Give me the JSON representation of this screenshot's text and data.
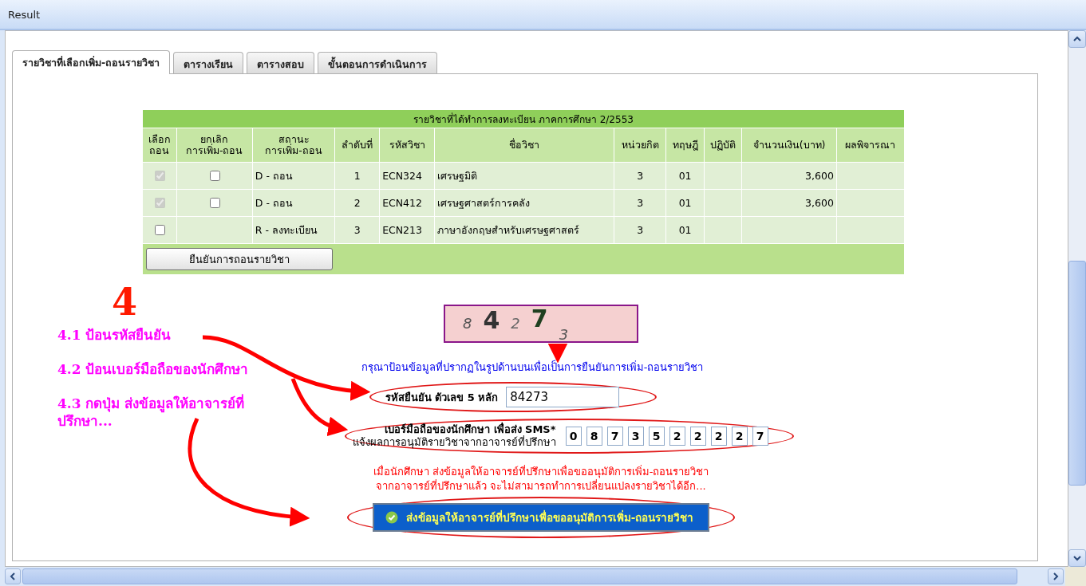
{
  "window": {
    "title": "Result"
  },
  "tabs": [
    {
      "label": "รายวิชาที่เลือกเพิ่ม-ถอนรายวิชา",
      "selected": true
    },
    {
      "label": "ตารางเรียน",
      "selected": false
    },
    {
      "label": "ตารางสอบ",
      "selected": false
    },
    {
      "label": "ขั้นตอนการดำเนินการ",
      "selected": false
    }
  ],
  "table": {
    "caption": "รายวิชาที่ได้ทำการลงทะเบียน ภาคการศึกษา 2/2553",
    "columns": [
      "เลือก\nถอน",
      "ยกเลิก\nการเพิ่ม-ถอน",
      "สถานะ\nการเพิ่ม-ถอน",
      "ลำดับที่",
      "รหัสวิชา",
      "ชื่อวิชา",
      "หน่วยกิต",
      "ทฤษฎี",
      "ปฏิบัติ",
      "จำนวนเงิน(บาท)",
      "ผลพิจารณา"
    ],
    "rows": [
      {
        "select": {
          "checked": true,
          "disabled": true
        },
        "cancel": {
          "checked": false
        },
        "status": "D - ถอน",
        "no": "1",
        "code": "ECN324",
        "name": "เศรษฐมิติ",
        "credits": "3",
        "theory": "01",
        "amount": "3,600"
      },
      {
        "select": {
          "checked": true,
          "disabled": true
        },
        "cancel": {
          "checked": false
        },
        "status": "D - ถอน",
        "no": "2",
        "code": "ECN412",
        "name": "เศรษฐศาสตร์การคลัง",
        "credits": "3",
        "theory": "01",
        "amount": "3,600"
      },
      {
        "select": {
          "checked": false,
          "disabled": false
        },
        "status": "R - ลงทะเบียน",
        "no": "3",
        "code": "ECN213",
        "name": "ภาษาอังกฤษสำหรับเศรษฐศาสตร์",
        "credits": "3",
        "theory": "01"
      }
    ],
    "button": "ยืนยันการถอนรายวิชา"
  },
  "captcha": [
    "8",
    "4",
    "2",
    "7",
    "3"
  ],
  "instruction": "กรุณาป้อนข้อมูลที่ปรากฏในรูปด้านบนเพื่อเป็นการยืนยันการเพิ่ม-ถอนรายวิชา",
  "code_field": {
    "label": "รหัสยืนยัน ตัวเลข 5 หลัก",
    "value": "84273"
  },
  "phone_field": {
    "label_lines": [
      "เบอร์มือถือของนักศึกษา เพื่อส่ง SMS*",
      "แจ้งผลการอนุมัติรายวิชาจากอาจารย์ที่ปรึกษา"
    ],
    "digits": [
      "0",
      "8",
      "7",
      "3",
      "5",
      "2",
      "2",
      "2",
      "2",
      "7"
    ]
  },
  "warning_lines": [
    "เมื่อนักศึกษา ส่งข้อมูลให้อาจารย์ที่ปรึกษาเพื่อขออนุมัติการเพิ่ม-ถอนรายวิชา",
    "จากอาจารย์ที่ปรึกษาแล้ว จะไม่สามารถทำการเปลี่ยนแปลงรายวิชาได้อีก..."
  ],
  "submit_button": "ส่งข้อมูลให้อาจารย์ที่ปรึกษาเพื่อขออนุมัติการเพิ่ม-ถอนรายวิชา",
  "annotation": {
    "step": "4",
    "items": [
      "4.1 ป้อนรหัสยืนยัน",
      "4.2 ป้อนเบอร์มือถือของนักศึกษา",
      "4.3 กดปุ่ม ส่งข้อมูลให้อาจารย์ที่ปรึกษา..."
    ]
  }
}
